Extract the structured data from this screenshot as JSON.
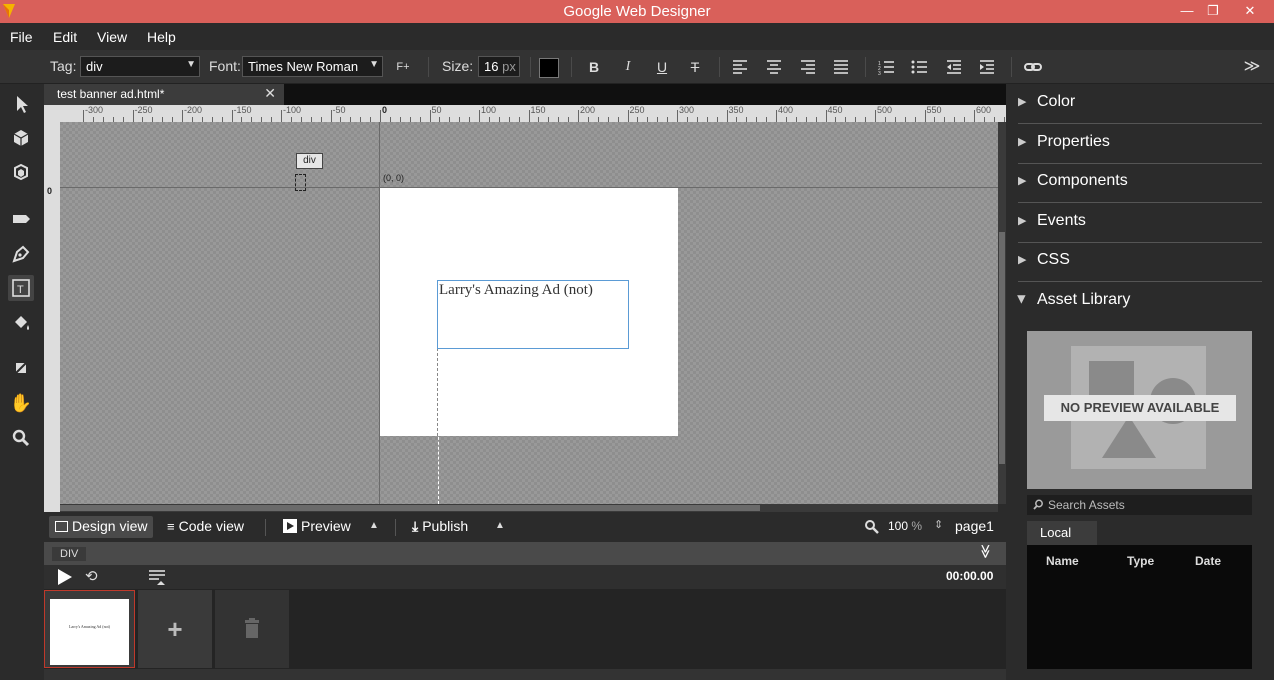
{
  "window": {
    "title": "Google Web Designer",
    "minimize": "—",
    "restore": "❐",
    "close": "✕"
  },
  "menu": [
    "File",
    "Edit",
    "View",
    "Help"
  ],
  "toolbar": {
    "tag_label": "Tag:",
    "tag_value": "div",
    "font_label": "Font:",
    "font_value": "Times New Roman",
    "font_plus": "F+",
    "size_label": "Size:",
    "size_value": "16",
    "size_unit": "px",
    "text_color": "#000000",
    "bold": "B",
    "italic": "I",
    "underline": "U",
    "strike": "T",
    "expand": "≫"
  },
  "document_tab": {
    "name": "test banner ad.html*",
    "close": "✕"
  },
  "ruler": {
    "h_labels": [
      "-300",
      "-250",
      "-200",
      "-150",
      "-100",
      "-50",
      "0",
      "50",
      "100",
      "150",
      "200",
      "250",
      "300",
      "350",
      "400",
      "450",
      "500",
      "550",
      "600"
    ],
    "v_zero": "0"
  },
  "stage": {
    "origin_label": "(0, 0)",
    "element_tag": "div",
    "text_content": "Larry's Amazing Ad (not)"
  },
  "viewbar": {
    "design_view": "Design view",
    "code_view": "Code view",
    "preview": "Preview",
    "publish": "Publish",
    "zoom_value": "100",
    "zoom_unit": "%",
    "page_name": "page1"
  },
  "timeline": {
    "breadcrumb": "DIV",
    "time": "00:00.00"
  },
  "pages": {
    "thumb_text": "Larry's Amazing Ad (not)"
  },
  "right_panel": {
    "sections": [
      "Color",
      "Properties",
      "Components",
      "Events",
      "CSS"
    ],
    "asset_library": "Asset Library",
    "no_preview": "NO PREVIEW AVAILABLE",
    "search_placeholder": "Search Assets",
    "local_tab": "Local",
    "columns": [
      "Name",
      "Type",
      "Date"
    ]
  },
  "colors": {
    "titlebar": "#d9605a",
    "accent_blue": "#5b9bd5",
    "page_thumb_border": "#c0392b"
  }
}
